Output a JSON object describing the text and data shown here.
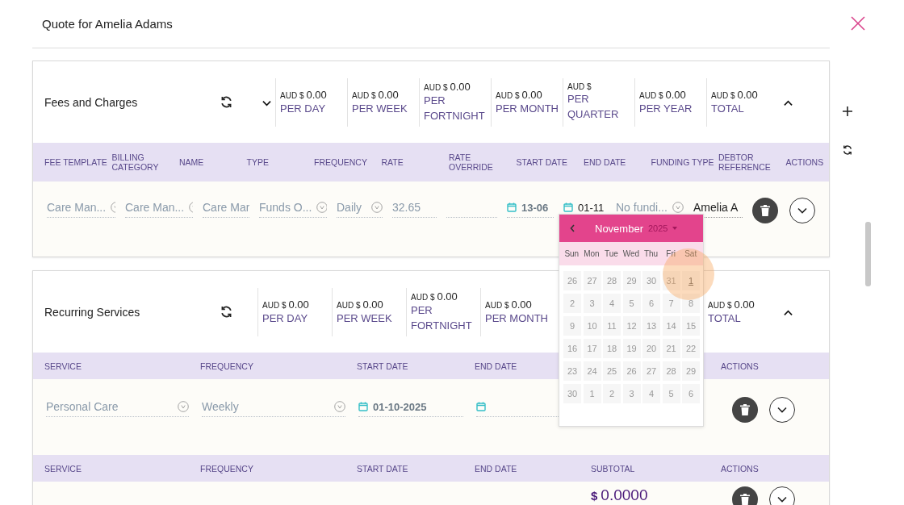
{
  "header": {
    "title": "Quote for Amelia Adams"
  },
  "sections": [
    {
      "kind": "fees",
      "title": "Fees and Charges",
      "menu": true,
      "expanded": true,
      "summary": [
        {
          "currency": "AUD $",
          "amount": "0.00",
          "period": "PER DAY"
        },
        {
          "currency": "AUD $",
          "amount": "0.00",
          "period": "PER WEEK"
        },
        {
          "currency": "AUD $",
          "amount": "0.00",
          "period": "PER FORTNIGHT"
        },
        {
          "currency": "AUD $",
          "amount": "0.00",
          "period": "PER MONTH"
        },
        {
          "currency": "AUD $",
          "period": "PER QUARTER"
        },
        {
          "currency": "AUD $",
          "amount": "0.00",
          "period": "PER YEAR"
        }
      ],
      "total": {
        "currency": "AUD $",
        "amount": "0.00",
        "period": "TOTAL"
      },
      "tables": [
        {
          "columns": [
            "FEE TEMPLATE",
            "BILLING CATEGORY",
            "NAME",
            "TYPE",
            "FREQUENCY",
            "RATE",
            "RATE OVERRIDE",
            "START DATE",
            "END DATE",
            "FUNDING TYPE",
            "DEBTOR REFERENCE",
            "ACTIONS"
          ],
          "rows": [
            {
              "cells": [
                {
                  "kind": "select",
                  "value": "Care Man...",
                  "focused": false
                },
                {
                  "kind": "select",
                  "value": "Care Man...",
                  "focused": false
                },
                {
                  "kind": "input",
                  "value": "Care Mar",
                  "focused": false
                },
                {
                  "kind": "select",
                  "value": "Funds O...",
                  "focused": false
                },
                {
                  "kind": "select",
                  "value": "Daily",
                  "focused": false
                },
                {
                  "kind": "input",
                  "value": "32.65",
                  "focused": false
                },
                {
                  "kind": "input",
                  "focused": false
                },
                {
                  "kind": "date",
                  "value": "13-06",
                  "focused": false
                },
                {
                  "kind": "date",
                  "value": "01-11",
                  "focused": true
                },
                {
                  "kind": "select",
                  "value": "No fundi...",
                  "focused": false
                },
                {
                  "kind": "input",
                  "value": "Amelia A",
                  "focused": true
                },
                {
                  "kind": "actions"
                }
              ]
            }
          ]
        }
      ]
    },
    {
      "kind": "recurring",
      "title": "Recurring Services",
      "menu": false,
      "expanded": true,
      "summary": [
        {
          "currency": "AUD $",
          "amount": "0.00",
          "period": "PER DAY"
        },
        {
          "currency": "AUD $",
          "amount": "0.00",
          "period": "PER WEEK"
        },
        {
          "currency": "AUD $",
          "amount": "0.00",
          "period": "PER FORTNIGHT"
        },
        {
          "currency": "AUD $",
          "amount": "0.00",
          "period": "PER MONTH"
        }
      ],
      "total": {
        "currency": "AUD $",
        "amount": "0.00",
        "period": "TOTAL"
      },
      "tables": [
        {
          "columns": [
            "SERVICE",
            "FREQUENCY",
            "START DATE",
            "END DATE",
            "ACTIONS"
          ],
          "rows": [
            {
              "cells": [
                {
                  "kind": "select",
                  "value": "Personal Care",
                  "focused": false
                },
                {
                  "kind": "select",
                  "value": "Weekly",
                  "focused": false
                },
                {
                  "kind": "date",
                  "value": "01-10-2025",
                  "focused": false
                },
                {
                  "kind": "date",
                  "focused": false
                },
                {
                  "kind": "actions"
                }
              ]
            }
          ]
        },
        {
          "columns": [
            "SERVICE",
            "FREQUENCY",
            "START DATE",
            "END DATE",
            "SUBTOTAL",
            "ACTIONS"
          ],
          "rows": [
            {
              "cells": [
                {
                  "kind": "blank"
                },
                {
                  "kind": "blank"
                },
                {
                  "kind": "blank"
                },
                {
                  "kind": "blank"
                },
                {
                  "kind": "money",
                  "currency": "$",
                  "amount": "0.0000"
                },
                {
                  "kind": "actions"
                }
              ]
            }
          ]
        }
      ]
    }
  ],
  "calendar": {
    "month": "November",
    "year": "2025",
    "weekdays": [
      "Sun",
      "Mon",
      "Tue",
      "Wed",
      "Thu",
      "Fri",
      "Sat"
    ],
    "days": [
      {
        "label": "26",
        "today": false
      },
      {
        "label": "27",
        "today": false
      },
      {
        "label": "28",
        "today": false
      },
      {
        "label": "29",
        "today": false
      },
      {
        "label": "30",
        "today": false
      },
      {
        "label": "31",
        "today": false
      },
      {
        "label": "1",
        "today": true
      },
      {
        "label": "2",
        "today": false
      },
      {
        "label": "3",
        "today": false
      },
      {
        "label": "4",
        "today": false
      },
      {
        "label": "5",
        "today": false
      },
      {
        "label": "6",
        "today": false
      },
      {
        "label": "7",
        "today": false
      },
      {
        "label": "8",
        "today": false
      },
      {
        "label": "9",
        "today": false
      },
      {
        "label": "10",
        "today": false
      },
      {
        "label": "11",
        "today": false
      },
      {
        "label": "12",
        "today": false
      },
      {
        "label": "13",
        "today": false
      },
      {
        "label": "14",
        "today": false
      },
      {
        "label": "15",
        "today": false
      },
      {
        "label": "16",
        "today": false
      },
      {
        "label": "17",
        "today": false
      },
      {
        "label": "18",
        "today": false
      },
      {
        "label": "19",
        "today": false
      },
      {
        "label": "20",
        "today": false
      },
      {
        "label": "21",
        "today": false
      },
      {
        "label": "22",
        "today": false
      },
      {
        "label": "23",
        "today": false
      },
      {
        "label": "24",
        "today": false
      },
      {
        "label": "25",
        "today": false
      },
      {
        "label": "26",
        "today": false
      },
      {
        "label": "27",
        "today": false
      },
      {
        "label": "28",
        "today": false
      },
      {
        "label": "29",
        "today": false
      },
      {
        "label": "30",
        "today": false
      },
      {
        "label": "1",
        "today": false
      },
      {
        "label": "2",
        "today": false
      },
      {
        "label": "3",
        "today": false
      },
      {
        "label": "4",
        "today": false
      },
      {
        "label": "5",
        "today": false
      },
      {
        "label": "6",
        "today": false
      }
    ]
  }
}
